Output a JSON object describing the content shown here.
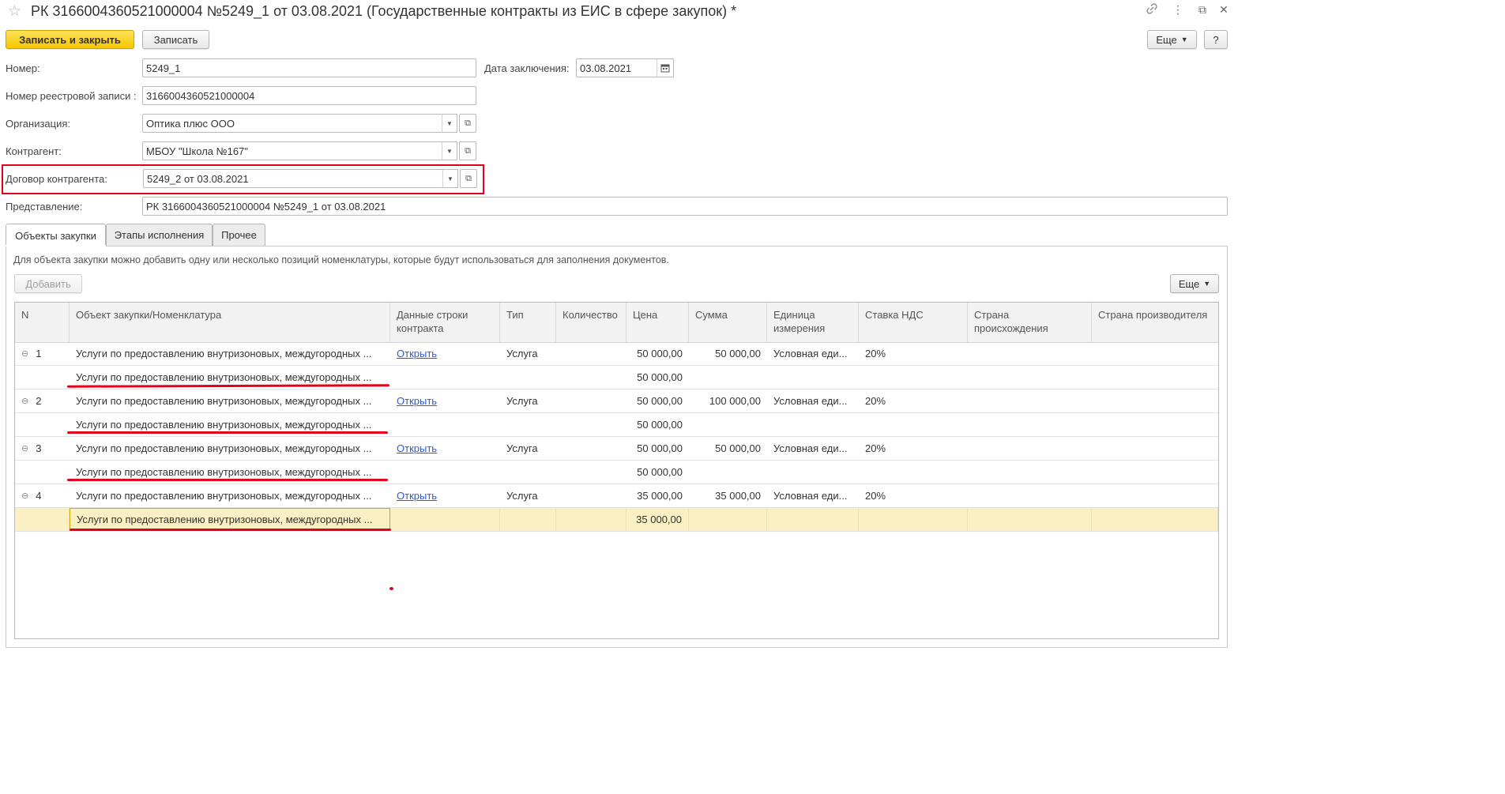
{
  "window": {
    "title": "РК 3166004360521000004 №5249_1 от 03.08.2021 (Государственные контракты из ЕИС в сфере закупок) *",
    "star_icon": "☆",
    "link_icon": "🔗",
    "menu_icon": "⋮",
    "restore_icon": "⧉",
    "close_icon": "✕"
  },
  "toolbar": {
    "save_close": "Записать и закрыть",
    "save": "Записать",
    "more": "Еще",
    "help": "?"
  },
  "form": {
    "number_label": "Номер:",
    "number_value": "5249_1",
    "date_label": "Дата заключения:",
    "date_value": "03.08.2021",
    "registry_label": "Номер реестровой записи :",
    "registry_value": "3166004360521000004",
    "org_label": "Организация:",
    "org_value": "Оптика плюс ООО",
    "contractor_label": "Контрагент:",
    "contractor_value": "МБОУ \"Школа №167\"",
    "contract_label": "Договор контрагента:",
    "contract_value": "5249_2 от 03.08.2021",
    "presentation_label": "Представление:",
    "presentation_value": "РК 3166004360521000004 №5249_1 от 03.08.2021"
  },
  "tabs": [
    "Объекты закупки",
    "Этапы исполнения",
    "Прочее"
  ],
  "panel": {
    "hint": "Для объекта закупки можно добавить одну или несколько позиций номенклатуры, которые будут использоваться для заполнения документов.",
    "add": "Добавить",
    "more": "Еще"
  },
  "table": {
    "headers": [
      "N",
      "Объект закупки/Номенклатура",
      "Данные строки контракта",
      "Тип",
      "Количество",
      "Цена",
      "Сумма",
      "Единица измерения",
      "Ставка НДС",
      "Страна происхождения",
      "Страна производителя"
    ],
    "rows": [
      {
        "n": "1",
        "object": "Услуги по предоставлению внутризоновых, междугородных ...",
        "data": "Открыть",
        "type": "Услуга",
        "qty": "",
        "price": "50 000,00",
        "sum": "50 000,00",
        "unit": "Условная еди...",
        "vat": "20%",
        "country_origin": "",
        "country_maker": ""
      },
      {
        "n": "",
        "object": "Услуги по предоставлению внутризоновых, междугородных ...",
        "data": "",
        "type": "",
        "qty": "",
        "price": "50 000,00",
        "sum": "",
        "unit": "",
        "vat": "",
        "country_origin": "",
        "country_maker": ""
      },
      {
        "n": "2",
        "object": "Услуги по предоставлению внутризоновых, междугородных ...",
        "data": "Открыть",
        "type": "Услуга",
        "qty": "",
        "price": "50 000,00",
        "sum": "100 000,00",
        "unit": "Условная еди...",
        "vat": "20%",
        "country_origin": "",
        "country_maker": ""
      },
      {
        "n": "",
        "object": "Услуги по предоставлению внутризоновых, междугородных ...",
        "data": "",
        "type": "",
        "qty": "",
        "price": "50 000,00",
        "sum": "",
        "unit": "",
        "vat": "",
        "country_origin": "",
        "country_maker": ""
      },
      {
        "n": "3",
        "object": "Услуги по предоставлению внутризоновых, междугородных ...",
        "data": "Открыть",
        "type": "Услуга",
        "qty": "",
        "price": "50 000,00",
        "sum": "50 000,00",
        "unit": "Условная еди...",
        "vat": "20%",
        "country_origin": "",
        "country_maker": ""
      },
      {
        "n": "",
        "object": "Услуги по предоставлению внутризоновых, междугородных ...",
        "data": "",
        "type": "",
        "qty": "",
        "price": "50 000,00",
        "sum": "",
        "unit": "",
        "vat": "",
        "country_origin": "",
        "country_maker": ""
      },
      {
        "n": "4",
        "object": "Услуги по предоставлению внутризоновых, междугородных ...",
        "data": "Открыть",
        "type": "Услуга",
        "qty": "",
        "price": "35 000,00",
        "sum": "35 000,00",
        "unit": "Условная еди...",
        "vat": "20%",
        "country_origin": "",
        "country_maker": ""
      },
      {
        "n": "",
        "object": "Услуги по предоставлению внутризоновых, междугородных ...",
        "data": "",
        "type": "",
        "qty": "",
        "price": "35 000,00",
        "sum": "",
        "unit": "",
        "vat": "",
        "country_origin": "",
        "country_maker": ""
      }
    ]
  },
  "colors": {
    "accent_yellow": "#f5c600",
    "annotation_red": "#e3001b",
    "selected_row": "#fbf0c4",
    "link": "#2a5bd7"
  }
}
